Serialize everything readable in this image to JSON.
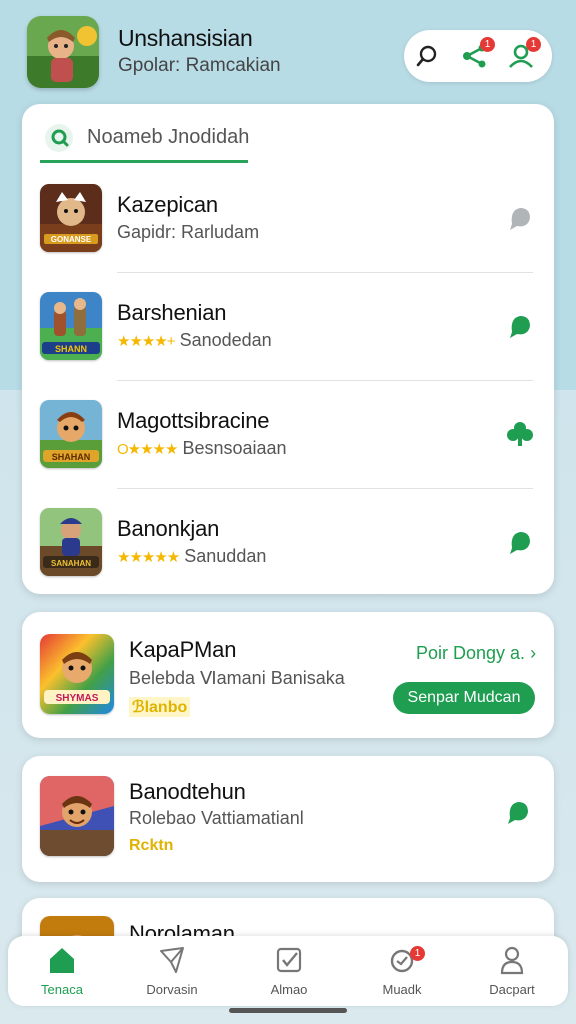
{
  "header": {
    "title": "Unshansisian",
    "subtitle": "Gpolar: Ramcakian"
  },
  "search": {
    "placeholder": "Noameb Jnodidah"
  },
  "list": [
    {
      "title": "Kazepican",
      "subtitle": "Gapidr: Rarludam",
      "stars": "",
      "thumb_label": "GONANSE"
    },
    {
      "title": "Barshenian",
      "subtitle": "Sanodedan",
      "stars": "★★★★+",
      "thumb_label": "SHANN"
    },
    {
      "title": "Magottsibracine",
      "subtitle": "Besnsoaiaan",
      "stars": "O★★★★",
      "thumb_label": "SHAHAN"
    },
    {
      "title": "Banonkjan",
      "subtitle": "Sanuddan",
      "stars": "★★★★★",
      "thumb_label": "SANAHAN"
    }
  ],
  "featured": [
    {
      "title": "KapaPMan",
      "subtitle": "Belebda Ⅵamani Banisaka",
      "tag": "ℬlanbo",
      "link": "Poir Dongy a.",
      "button": "Senpar Mudcan",
      "thumb_label": "SHYMAS"
    },
    {
      "title": "Banodtehun",
      "subtitle": "Rolebao Vattiamatianl",
      "tag": "Rcktn",
      "link": "",
      "button": "",
      "thumb_label": ""
    },
    {
      "title": "Norolaman",
      "subtitle": "",
      "tag": "",
      "link": "",
      "button": "",
      "thumb_label": ""
    }
  ],
  "nav": [
    {
      "label": "Tenaca",
      "icon": "home-icon",
      "active": true
    },
    {
      "label": "Dorvasin",
      "icon": "send-icon",
      "active": false
    },
    {
      "label": "Almao",
      "icon": "checkbox-icon",
      "active": false
    },
    {
      "label": "Muadk",
      "icon": "badge-icon",
      "active": false,
      "badge": "1"
    },
    {
      "label": "Dacpart",
      "icon": "person-icon",
      "active": false
    }
  ],
  "badges": {
    "share": "1",
    "profile": "1"
  },
  "colors": {
    "accent": "#1f9e52",
    "star": "#f5b800",
    "badge": "#e53935"
  }
}
